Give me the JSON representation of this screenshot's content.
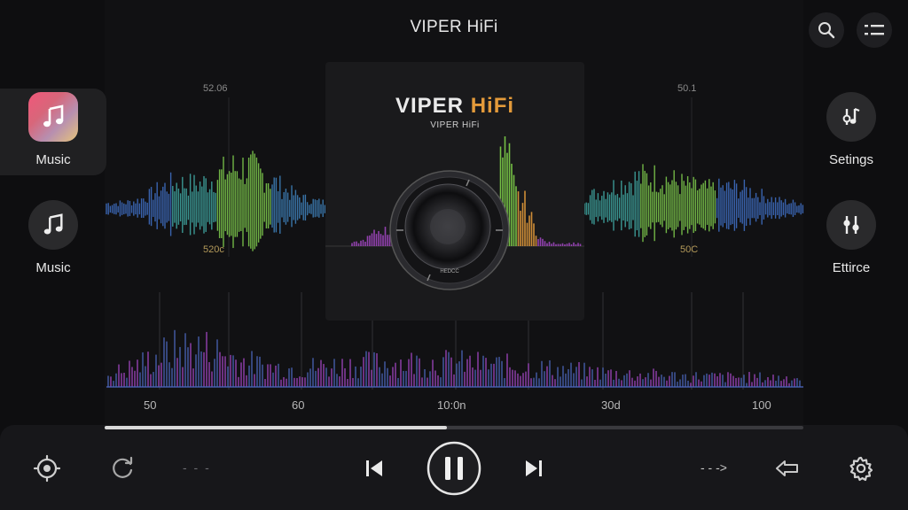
{
  "header": {
    "title": "VIPER HiFi",
    "search_icon": "search-icon",
    "menu_icon": "list-icon"
  },
  "sidebar_left": {
    "items": [
      {
        "label": "Music",
        "icon": "music-note-icon",
        "active": true
      },
      {
        "label": "Music",
        "icon": "music-note-icon",
        "active": false
      }
    ]
  },
  "sidebar_right": {
    "items": [
      {
        "label": "Setings",
        "icon": "music-sliders-icon"
      },
      {
        "label": "Ettirce",
        "icon": "equalizer-icon"
      }
    ]
  },
  "visualizer": {
    "freq_labels": {
      "top_left": "52.06",
      "bottom_left": "520c",
      "top_right": "50.1",
      "bottom_right": "50C"
    },
    "axis_ticks": [
      "50",
      "60",
      "10:0n",
      "30d",
      "100"
    ]
  },
  "album": {
    "logo_main": "VIPER ",
    "logo_accent": "HiFi",
    "logo_sub": "VIPER HiFi",
    "speaker_label": "HEDCC"
  },
  "player": {
    "progress": 0.49,
    "controls": {
      "left_button_icon": "sun-target-icon",
      "repeat_icon": "repeat-icon",
      "left_dots": "- - -",
      "prev_icon": "skip-previous-icon",
      "play_pause_icon": "pause-icon",
      "next_icon": "skip-next-icon",
      "right_dots": "- - ->",
      "share_icon": "arrow-share-icon",
      "settings_icon": "gear-icon"
    }
  },
  "colors": {
    "background": "#0e0e10",
    "panel": "#17171a",
    "accent_orange": "#e39a3a",
    "wave_green": "#7fd14a",
    "wave_teal": "#3fa5a0",
    "wave_blue": "#3e5fb5",
    "wave_purple": "#a046c0"
  }
}
